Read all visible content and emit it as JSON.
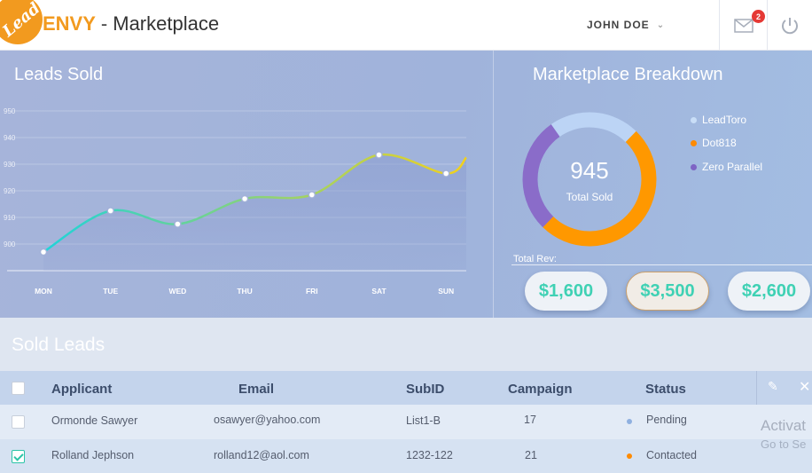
{
  "header": {
    "logo_text": "Lead",
    "brand": "ENVY",
    "separator": "-",
    "page": "Marketplace",
    "user_name": "JOHN DOE",
    "mail_count": "2"
  },
  "leads_sold": {
    "title": "Leads Sold"
  },
  "chart_data": {
    "type": "line",
    "x": [
      "MON",
      "TUE",
      "WED",
      "THU",
      "FRI",
      "SAT",
      "SUN"
    ],
    "series": [
      {
        "values": [
          897,
          912.5,
          907.5,
          917,
          918.5,
          933.5,
          926.5
        ]
      }
    ],
    "y_ticks": [
      900,
      910,
      920,
      930,
      940,
      950
    ],
    "ylim": [
      890,
      950
    ],
    "grid": true,
    "gradient_colors": [
      "#1fd3d9",
      "#f2d11c"
    ]
  },
  "breakdown": {
    "title": "Marketplace Breakdown",
    "total_value": "945",
    "total_label": "Total Sold",
    "legend": [
      {
        "label": "LeadToro",
        "color": "#c9def7"
      },
      {
        "label": "Dot818",
        "color": "#ff8a00"
      },
      {
        "label": "Zero Parallel",
        "color": "#7e64c4"
      }
    ],
    "donut": [
      {
        "name": "LeadToro",
        "fraction": 0.22,
        "color": "#bcd4f5"
      },
      {
        "name": "Dot818",
        "fraction": 0.5,
        "color": "#ff9800"
      },
      {
        "name": "Zero Parallel",
        "fraction": 0.28,
        "color": "#8a6cc9"
      }
    ],
    "total_rev_label": "Total Rev:",
    "revenues": [
      "$1,600",
      "$3,500",
      "$2,600"
    ]
  },
  "sold_leads": {
    "title": "Sold Leads",
    "columns": [
      "Applicant",
      "Email",
      "SubID",
      "Campaign",
      "Status"
    ],
    "rows": [
      {
        "applicant": "Ormonde Sawyer",
        "email": "osawyer@yahoo.com",
        "subid": "List1-B",
        "campaign": "17",
        "status": "Pending",
        "status_color": "#8fb0e0",
        "checked": false
      },
      {
        "applicant": "Rolland Jephson",
        "email": "rolland12@aol.com",
        "subid": "1232-122",
        "campaign": "21",
        "status": "Contacted",
        "status_color": "#ff8a00",
        "checked": true
      }
    ]
  },
  "overlay": {
    "watermark": "Activat",
    "watermark_sub": "Go to Se"
  }
}
